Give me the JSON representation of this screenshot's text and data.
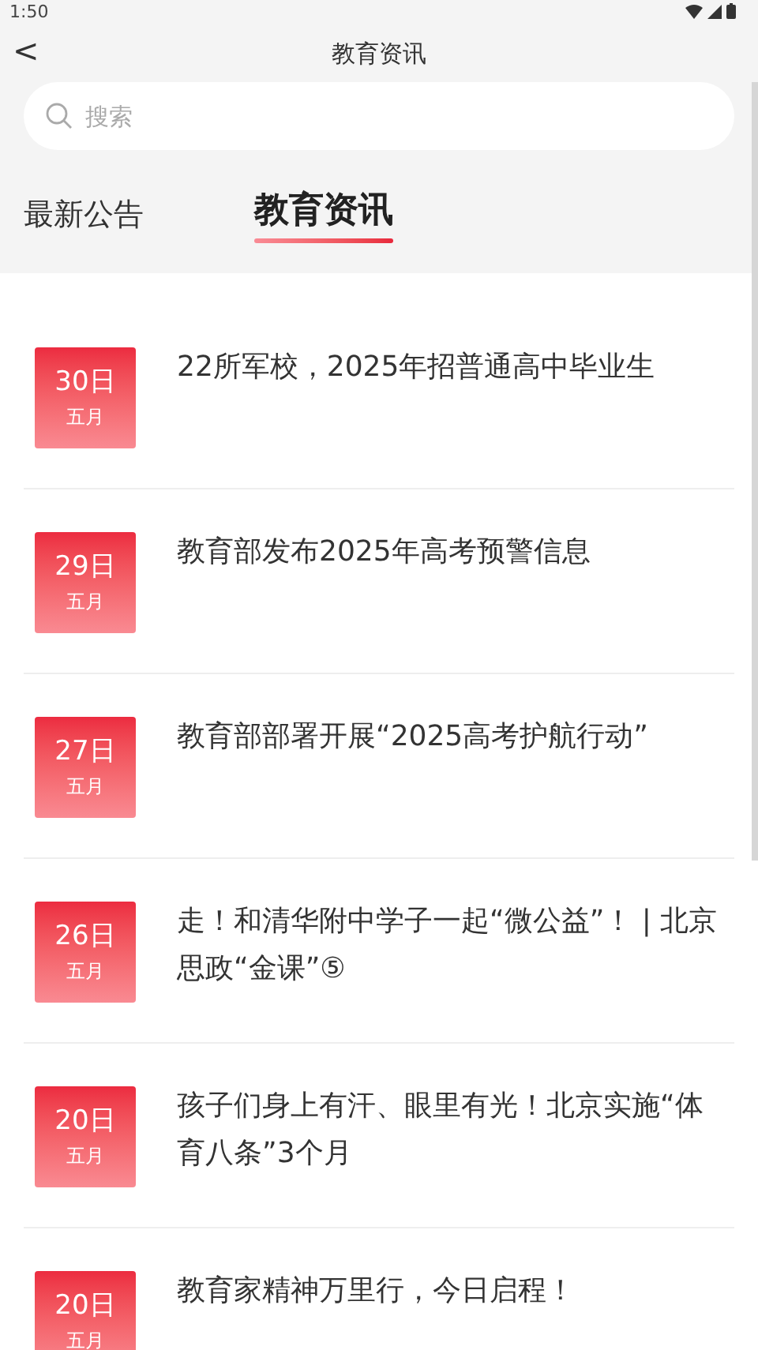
{
  "status_bar": {
    "time": "1:50"
  },
  "header": {
    "back": "<",
    "title": "教育资讯"
  },
  "search": {
    "placeholder": "搜索"
  },
  "tabs": [
    {
      "label": "最新公告",
      "selected": false
    },
    {
      "label": "教育资讯",
      "selected": true
    }
  ],
  "articles": [
    {
      "day": "30日",
      "month": "五月",
      "title": "22所军校，2025年招普通高中毕业生"
    },
    {
      "day": "29日",
      "month": "五月",
      "title": "教育部发布2025年高考预警信息"
    },
    {
      "day": "27日",
      "month": "五月",
      "title": "教育部部署开展“2025高考护航行动”"
    },
    {
      "day": "26日",
      "month": "五月",
      "title": "走！和清华附中学子一起“微公益”！ | 北京思政“金课”⑤"
    },
    {
      "day": "20日",
      "month": "五月",
      "title": "孩子们身上有汗、眼里有光！北京实施“体育八条”3个月"
    },
    {
      "day": "20日",
      "month": "五月",
      "title": "教育家精神万里行，今日启程！"
    }
  ]
}
